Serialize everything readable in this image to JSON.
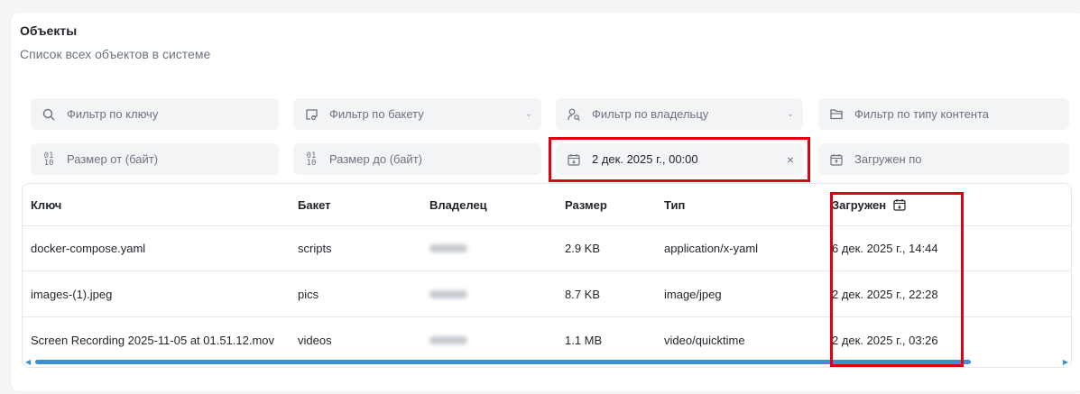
{
  "header": {
    "title": "Объекты",
    "subtitle": "Список всех объектов в системе"
  },
  "filters": {
    "key": {
      "placeholder": "Фильтр по ключу",
      "icon": "search-icon"
    },
    "bucket": {
      "placeholder": "Фильтр по бакету",
      "icon": "bucket-icon"
    },
    "owner": {
      "placeholder": "Фильтр по владельцу",
      "icon": "user-search-icon"
    },
    "content_type": {
      "placeholder": "Фильтр по типу контента",
      "icon": "folder-icon"
    },
    "size_from": {
      "placeholder": "Размер от (байт)",
      "icon": "numbers-icon"
    },
    "size_to": {
      "placeholder": "Размер до (байт)",
      "icon": "numbers-icon"
    },
    "uploaded_from": {
      "value": "2 дек. 2025 г., 00:00",
      "icon": "calendar-icon"
    },
    "uploaded_to": {
      "placeholder": "Загружен по",
      "icon": "calendar-icon"
    }
  },
  "table": {
    "columns": [
      "Ключ",
      "Бакет",
      "Владелец",
      "Размер",
      "Тип",
      "Загружен"
    ],
    "rows": [
      {
        "key": "docker-compose.yaml",
        "bucket": "scripts",
        "size": "2.9 KB",
        "type": "application/x-yaml",
        "uploaded": "6 дек. 2025 г., 14:44"
      },
      {
        "key": "images-(1).jpeg",
        "bucket": "pics",
        "size": "8.7 KB",
        "type": "image/jpeg",
        "uploaded": "2 дек. 2025 г., 22:28"
      },
      {
        "key": "Screen Recording 2025-11-05 at 01.51.12.mov",
        "bucket": "videos",
        "size": "1.1 MB",
        "type": "video/quicktime",
        "uploaded": "2 дек. 2025 г., 03:26"
      }
    ]
  },
  "colors": {
    "highlight": "#e0000f",
    "scrollbar": "#3b8fd4"
  }
}
